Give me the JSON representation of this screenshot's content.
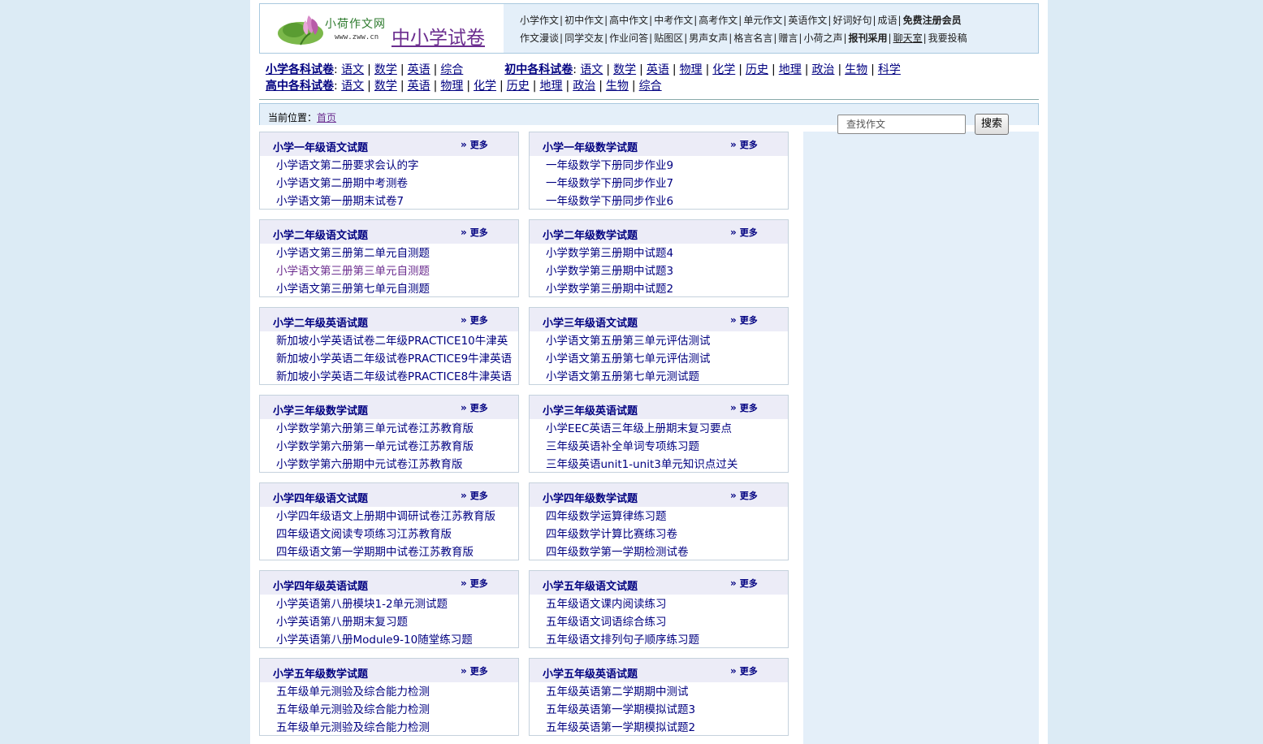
{
  "header": {
    "logo_text": "小荷作文网",
    "logo_url": "www.zww.cn",
    "site_title": "中小学试卷",
    "nav_row1": [
      "小学作文",
      "初中作文",
      "高中作文",
      "中考作文",
      "高考作文",
      "单元作文",
      "英语作文",
      "好词好句",
      "成语",
      "免费注册会员"
    ],
    "nav_row2": [
      "作文漫谈",
      "同学交友",
      "作业问答",
      "贴图区",
      "男声女声",
      "格言名言",
      "赠言",
      "小荷之声",
      "报刊采用",
      "聊天室",
      "我要投稿"
    ]
  },
  "subjects": {
    "primary_label": "小学各科试卷",
    "primary": [
      "语文",
      "数学",
      "英语",
      "综合"
    ],
    "junior_label": "初中各科试卷",
    "junior": [
      "语文",
      "数学",
      "英语",
      "物理",
      "化学",
      "历史",
      "地理",
      "政治",
      "生物",
      "科学"
    ],
    "senior_label": "高中各科试卷",
    "senior": [
      "语文",
      "数学",
      "英语",
      "物理",
      "化学",
      "历史",
      "地理",
      "政治",
      "生物",
      "综合"
    ]
  },
  "breadcrumb": {
    "label": "当前位置：",
    "home": "首页"
  },
  "search": {
    "placeholder": "查找作文",
    "button": "搜索"
  },
  "more_label": "更多",
  "sections": [
    {
      "title": "小学一年级语文试题",
      "items": [
        "小学语文第二册要求会认的字",
        "小学语文第二册期中考测卷",
        "小学语文第一册期末试卷7"
      ]
    },
    {
      "title": "小学一年级数学试题",
      "items": [
        "一年级数学下册同步作业9",
        "一年级数学下册同步作业7",
        "一年级数学下册同步作业6"
      ]
    },
    {
      "title": "小学二年级语文试题",
      "items": [
        "小学语文第三册第二单元自测题",
        "小学语文第三册第三单元自测题",
        "小学语文第三册第七单元自测题"
      ]
    },
    {
      "title": "小学二年级数学试题",
      "items": [
        "小学数学第三册期中试题4",
        "小学数学第三册期中试题3",
        "小学数学第三册期中试题2"
      ]
    },
    {
      "title": "小学二年级英语试题",
      "items": [
        "新加坡小学英语试卷二年级PRACTICE10牛津英",
        "新加坡小学英语二年级试卷PRACTICE9牛津英语",
        "新加坡小学英语二年级试卷PRACTICE8牛津英语"
      ]
    },
    {
      "title": "小学三年级语文试题",
      "items": [
        "小学语文第五册第三单元评估测试",
        "小学语文第五册第七单元评估测试",
        "小学语文第五册第七单元测试题"
      ]
    },
    {
      "title": "小学三年级数学试题",
      "items": [
        "小学数学第六册第三单元试卷江苏教育版",
        "小学数学第六册第一单元试卷江苏教育版",
        "小学数学第六册期中元试卷江苏教育版"
      ]
    },
    {
      "title": "小学三年级英语试题",
      "items": [
        "小学EEC英语三年级上册期末复习要点",
        "三年级英语补全单词专项练习题",
        "三年级英语unit1-unit3单元知识点过关"
      ]
    },
    {
      "title": "小学四年级语文试题",
      "items": [
        "小学四年级语文上册期中调研试卷江苏教育版",
        "四年级语文阅读专项练习江苏教育版",
        "四年级语文第一学期期中试卷江苏教育版"
      ]
    },
    {
      "title": "小学四年级数学试题",
      "items": [
        "四年级数学运算律练习题",
        "四年级数学计算比赛练习卷",
        "四年级数学第一学期检测试卷"
      ]
    },
    {
      "title": "小学四年级英语试题",
      "items": [
        "小学英语第八册模块1-2单元测试题",
        "小学英语第八册期末复习题",
        "小学英语第八册Module9-10随堂练习题"
      ]
    },
    {
      "title": "小学五年级语文试题",
      "items": [
        "五年级语文课内阅读练习",
        "五年级语文词语综合练习",
        "五年级语文排列句子顺序练习题"
      ]
    },
    {
      "title": "小学五年级数学试题",
      "items": [
        "五年级单元测验及综合能力检测",
        "五年级单元测验及综合能力检测",
        "五年级单元测验及综合能力检测"
      ]
    },
    {
      "title": "小学五年级英语试题",
      "items": [
        "五年级英语第二学期期中测试",
        "五年级英语第一学期模拟试题3",
        "五年级英语第一学期模拟试题2"
      ]
    }
  ]
}
